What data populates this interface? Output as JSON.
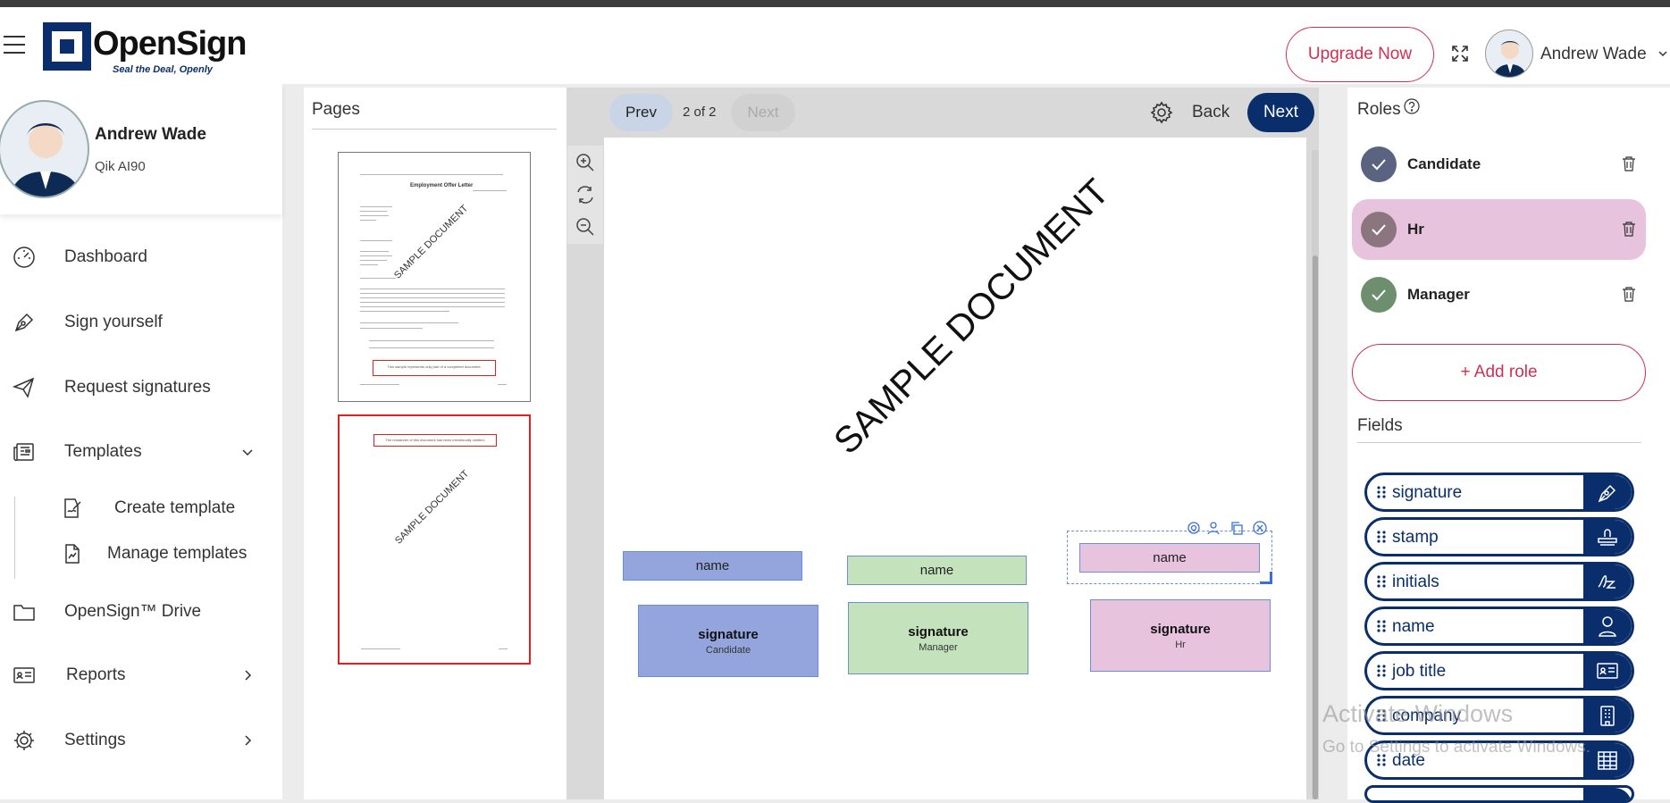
{
  "header": {
    "logo_text": "OpenSign",
    "logo_tagline": "Seal the Deal, Openly",
    "upgrade_label": "Upgrade Now",
    "user_name": "Andrew Wade"
  },
  "sidebar": {
    "profile": {
      "name": "Andrew Wade",
      "company": "Qik AI90"
    },
    "items": [
      {
        "label": "Dashboard"
      },
      {
        "label": "Sign yourself"
      },
      {
        "label": "Request signatures"
      },
      {
        "label": "Templates"
      },
      {
        "label": "Create template"
      },
      {
        "label": "Manage templates"
      },
      {
        "label": "OpenSign™ Drive"
      },
      {
        "label": "Reports"
      },
      {
        "label": "Settings"
      }
    ]
  },
  "pages_panel": {
    "title": "Pages",
    "thumb1": {
      "doc_title": "Employment Offer Letter",
      "watermark": "SAMPLE DOCUMENT",
      "box_text": "This sample represents only part of a completed document."
    },
    "thumb2": {
      "box_text": "The remainder of this document has been intentionally omitted.",
      "watermark": "SAMPLE DOCUMENT"
    }
  },
  "doc_toolbar": {
    "prev_label": "Prev",
    "page_count": "2 of 2",
    "next_disabled_label": "Next",
    "back_label": "Back",
    "next_label": "Next"
  },
  "document": {
    "watermark": "SAMPLE DOCUMENT",
    "fields": [
      {
        "type": "name",
        "label": "name",
        "role": "Candidate",
        "color": "#94a5de"
      },
      {
        "type": "name",
        "label": "name",
        "role": "Manager",
        "color": "#c4e3bd"
      },
      {
        "type": "name",
        "label": "name",
        "role": "Hr",
        "color": "#e7c3dd"
      },
      {
        "type": "signature",
        "label": "signature",
        "role_label": "Candidate",
        "color": "#94a5de"
      },
      {
        "type": "signature",
        "label": "signature",
        "role_label": "Manager",
        "color": "#c4e3bd"
      },
      {
        "type": "signature",
        "label": "signature",
        "role_label": "Hr",
        "color": "#e7c3dd"
      }
    ]
  },
  "roles": {
    "title": "Roles",
    "items": [
      {
        "label": "Candidate",
        "dot_color": "#5a6480",
        "bg": "#ffffff"
      },
      {
        "label": "Hr",
        "dot_color": "#8b7680",
        "bg": "#e7c3dd"
      },
      {
        "label": "Manager",
        "dot_color": "#6e8f6e",
        "bg": "#ffffff"
      }
    ],
    "add_label": "+  Add role"
  },
  "fields": {
    "title": "Fields",
    "items": [
      {
        "label": "signature",
        "icon": "pen-icon"
      },
      {
        "label": "stamp",
        "icon": "stamp-icon"
      },
      {
        "label": "initials",
        "icon": "initials-icon"
      },
      {
        "label": "name",
        "icon": "user-icon"
      },
      {
        "label": "job title",
        "icon": "id-card-icon"
      },
      {
        "label": "company",
        "icon": "building-icon"
      },
      {
        "label": "date",
        "icon": "calendar-icon"
      }
    ]
  },
  "os_overlay": {
    "line1": "Activate Windows",
    "line2": "Go to Settings to activate Windows."
  },
  "colors": {
    "brand": "#0a2e6b",
    "accent": "#d32f50"
  }
}
